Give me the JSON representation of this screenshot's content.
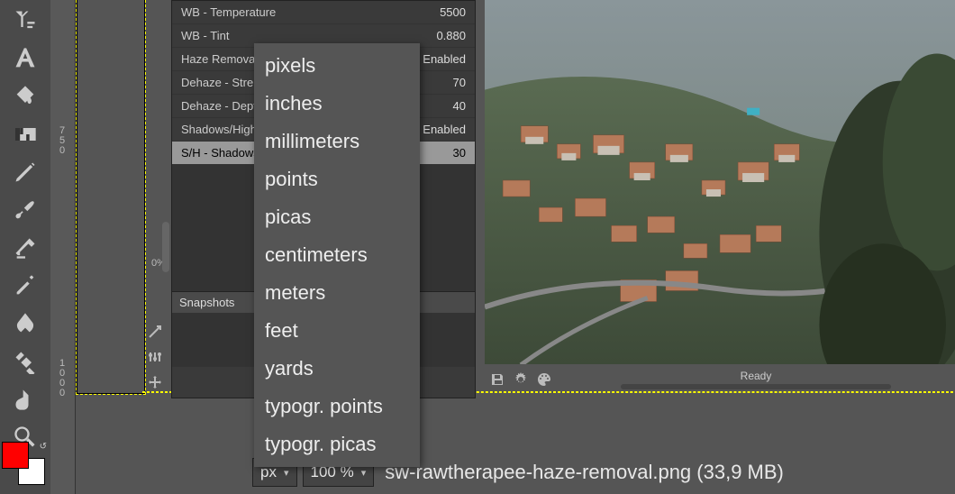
{
  "ruler": {
    "mark1": "7\n5\n0",
    "mark2": "1\n0\n0\n0"
  },
  "params": [
    {
      "label": "WB - Temperature",
      "value": "5500"
    },
    {
      "label": "WB - Tint",
      "value": "0.880"
    },
    {
      "label": "Haze Removal",
      "value": "Enabled"
    },
    {
      "label": "Dehaze - Strength",
      "value": "70"
    },
    {
      "label": "Dehaze - Depth",
      "value": "40"
    },
    {
      "label": "Shadows/Highlights",
      "value": "Enabled"
    },
    {
      "label": "S/H - Shadows",
      "value": "30",
      "highlight": true
    }
  ],
  "snapshots": {
    "title": "Snapshots",
    "add_label": "+"
  },
  "zoom_tiny": "0%",
  "status": {
    "ready": "Ready"
  },
  "bottom": {
    "unit_selected": "px",
    "zoom": "100 %",
    "filename": "sw-rawtherapee-haze-removal.png (33,9 MB)"
  },
  "unit_menu": [
    "pixels",
    "inches",
    "millimeters",
    "points",
    "picas",
    "centimeters",
    "meters",
    "feet",
    "yards",
    "typogr. points",
    "typogr. picas"
  ]
}
